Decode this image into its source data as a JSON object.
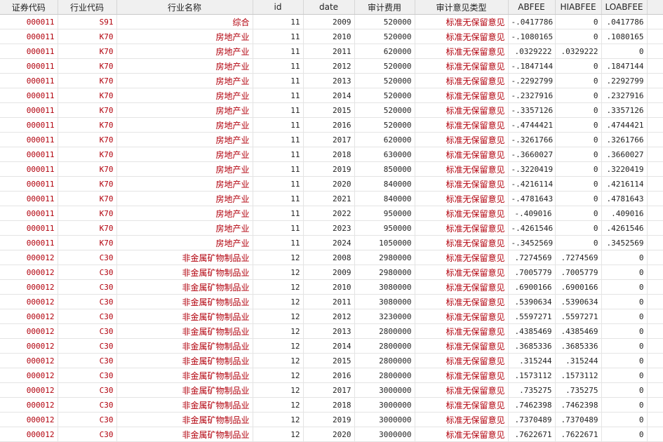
{
  "columns": [
    "证券代码",
    "行业代码",
    "行业名称",
    "id",
    "date",
    "审计费用",
    "审计意见类型",
    "ABFEE",
    "HIABFEE",
    "LOABFEE"
  ],
  "rows": [
    [
      "000011",
      "S91",
      "综合",
      "11",
      "2009",
      "520000",
      "标准无保留意见",
      "-.0417786",
      "0",
      ".0417786"
    ],
    [
      "000011",
      "K70",
      "房地产业",
      "11",
      "2010",
      "520000",
      "标准无保留意见",
      "-.1080165",
      "0",
      ".1080165"
    ],
    [
      "000011",
      "K70",
      "房地产业",
      "11",
      "2011",
      "620000",
      "标准无保留意见",
      ".0329222",
      ".0329222",
      "0"
    ],
    [
      "000011",
      "K70",
      "房地产业",
      "11",
      "2012",
      "520000",
      "标准无保留意见",
      "-.1847144",
      "0",
      ".1847144"
    ],
    [
      "000011",
      "K70",
      "房地产业",
      "11",
      "2013",
      "520000",
      "标准无保留意见",
      "-.2292799",
      "0",
      ".2292799"
    ],
    [
      "000011",
      "K70",
      "房地产业",
      "11",
      "2014",
      "520000",
      "标准无保留意见",
      "-.2327916",
      "0",
      ".2327916"
    ],
    [
      "000011",
      "K70",
      "房地产业",
      "11",
      "2015",
      "520000",
      "标准无保留意见",
      "-.3357126",
      "0",
      ".3357126"
    ],
    [
      "000011",
      "K70",
      "房地产业",
      "11",
      "2016",
      "520000",
      "标准无保留意见",
      "-.4744421",
      "0",
      ".4744421"
    ],
    [
      "000011",
      "K70",
      "房地产业",
      "11",
      "2017",
      "620000",
      "标准无保留意见",
      "-.3261766",
      "0",
      ".3261766"
    ],
    [
      "000011",
      "K70",
      "房地产业",
      "11",
      "2018",
      "630000",
      "标准无保留意见",
      "-.3660027",
      "0",
      ".3660027"
    ],
    [
      "000011",
      "K70",
      "房地产业",
      "11",
      "2019",
      "850000",
      "标准无保留意见",
      "-.3220419",
      "0",
      ".3220419"
    ],
    [
      "000011",
      "K70",
      "房地产业",
      "11",
      "2020",
      "840000",
      "标准无保留意见",
      "-.4216114",
      "0",
      ".4216114"
    ],
    [
      "000011",
      "K70",
      "房地产业",
      "11",
      "2021",
      "840000",
      "标准无保留意见",
      "-.4781643",
      "0",
      ".4781643"
    ],
    [
      "000011",
      "K70",
      "房地产业",
      "11",
      "2022",
      "950000",
      "标准无保留意见",
      "-.409016",
      "0",
      ".409016"
    ],
    [
      "000011",
      "K70",
      "房地产业",
      "11",
      "2023",
      "950000",
      "标准无保留意见",
      "-.4261546",
      "0",
      ".4261546"
    ],
    [
      "000011",
      "K70",
      "房地产业",
      "11",
      "2024",
      "1050000",
      "标准无保留意见",
      "-.3452569",
      "0",
      ".3452569"
    ],
    [
      "000012",
      "C30",
      "非金属矿物制品业",
      "12",
      "2008",
      "2980000",
      "标准无保留意见",
      ".7274569",
      ".7274569",
      "0"
    ],
    [
      "000012",
      "C30",
      "非金属矿物制品业",
      "12",
      "2009",
      "2980000",
      "标准无保留意见",
      ".7005779",
      ".7005779",
      "0"
    ],
    [
      "000012",
      "C30",
      "非金属矿物制品业",
      "12",
      "2010",
      "3080000",
      "标准无保留意见",
      ".6900166",
      ".6900166",
      "0"
    ],
    [
      "000012",
      "C30",
      "非金属矿物制品业",
      "12",
      "2011",
      "3080000",
      "标准无保留意见",
      ".5390634",
      ".5390634",
      "0"
    ],
    [
      "000012",
      "C30",
      "非金属矿物制品业",
      "12",
      "2012",
      "3230000",
      "标准无保留意见",
      ".5597271",
      ".5597271",
      "0"
    ],
    [
      "000012",
      "C30",
      "非金属矿物制品业",
      "12",
      "2013",
      "2800000",
      "标准无保留意见",
      ".4385469",
      ".4385469",
      "0"
    ],
    [
      "000012",
      "C30",
      "非金属矿物制品业",
      "12",
      "2014",
      "2800000",
      "标准无保留意见",
      ".3685336",
      ".3685336",
      "0"
    ],
    [
      "000012",
      "C30",
      "非金属矿物制品业",
      "12",
      "2015",
      "2800000",
      "标准无保留意见",
      ".315244",
      ".315244",
      "0"
    ],
    [
      "000012",
      "C30",
      "非金属矿物制品业",
      "12",
      "2016",
      "2800000",
      "标准无保留意见",
      ".1573112",
      ".1573112",
      "0"
    ],
    [
      "000012",
      "C30",
      "非金属矿物制品业",
      "12",
      "2017",
      "3000000",
      "标准无保留意见",
      ".735275",
      ".735275",
      "0"
    ],
    [
      "000012",
      "C30",
      "非金属矿物制品业",
      "12",
      "2018",
      "3000000",
      "标准无保留意见",
      ".7462398",
      ".7462398",
      "0"
    ],
    [
      "000012",
      "C30",
      "非金属矿物制品业",
      "12",
      "2019",
      "3000000",
      "标准无保留意见",
      ".7370489",
      ".7370489",
      "0"
    ],
    [
      "000012",
      "C30",
      "非金属矿物制品业",
      "12",
      "2020",
      "3000000",
      "标准无保留意见",
      ".7622671",
      ".7622671",
      "0"
    ]
  ],
  "column_types": [
    "str",
    "str",
    "str",
    "num",
    "num",
    "num",
    "str",
    "num",
    "num",
    "num"
  ],
  "colors": {
    "string_text": "#b2000c",
    "numeric_text": "#222222",
    "header_bg": "#f0f0f0",
    "grid_line": "#e4e4e4"
  }
}
